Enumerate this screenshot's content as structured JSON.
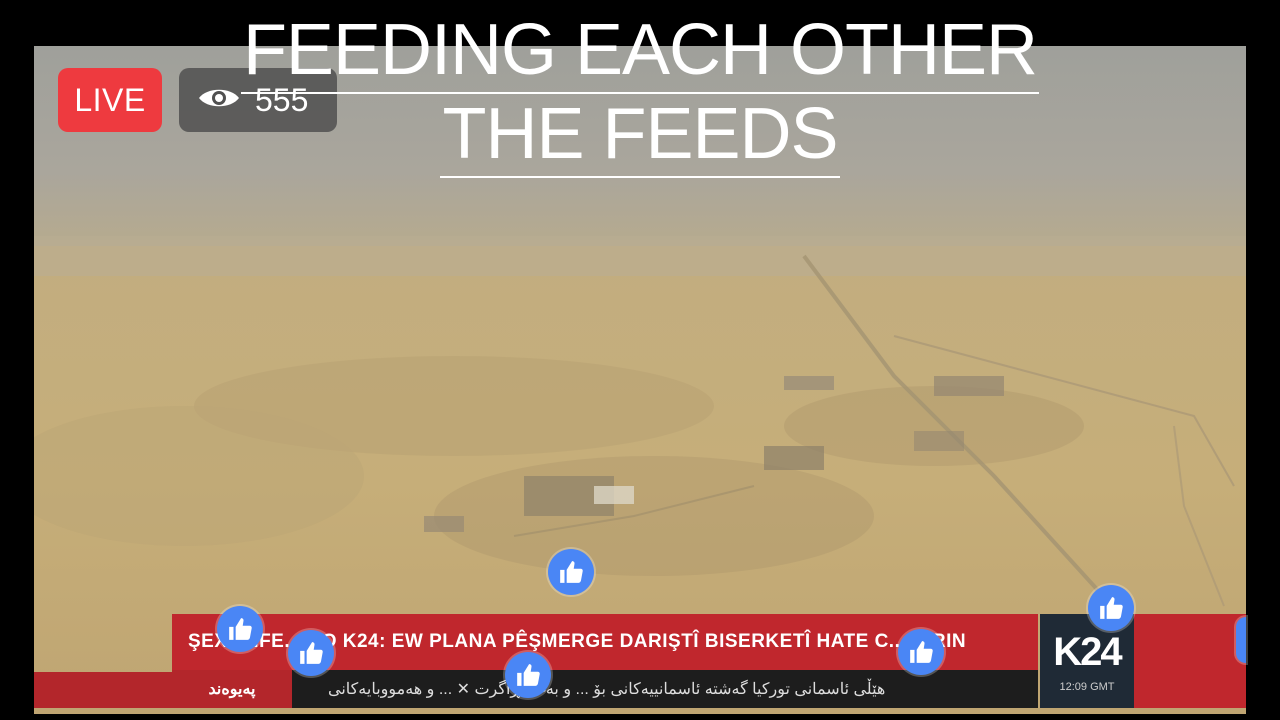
{
  "overlay": {
    "title_line1": "FEEDING EACH OTHER",
    "title_line2": "THE FEEDS"
  },
  "live_badge": {
    "label": "LIVE",
    "color": "#ee3a3f"
  },
  "viewers": {
    "count": "555",
    "icon": "eye-icon"
  },
  "ticker": {
    "headline": "ŞEX...HFE... BO K24: EW PLANA PÊŞMERGE DARIŞTÎ BISERKETÎ HATE C... KIRIN",
    "tab_label": "پەیوەند",
    "scroll_text": "هێڵی ئاسمانی تورکیا گەشتە ئاسمانییەکانی بۆ ... و بەغدا ڕاگرت  ✕  ... و هەمووبایەکانی",
    "headline_bg": "#c0272d",
    "tab_bg": "#b3262b"
  },
  "channel_logo": {
    "name": "K24",
    "time": "12:09 GMT"
  },
  "reaction_icon": "thumbs-up-icon",
  "colors": {
    "like_blue": "#4a86f5",
    "sky": "#a6a39c",
    "ground": "#c3ac78"
  }
}
